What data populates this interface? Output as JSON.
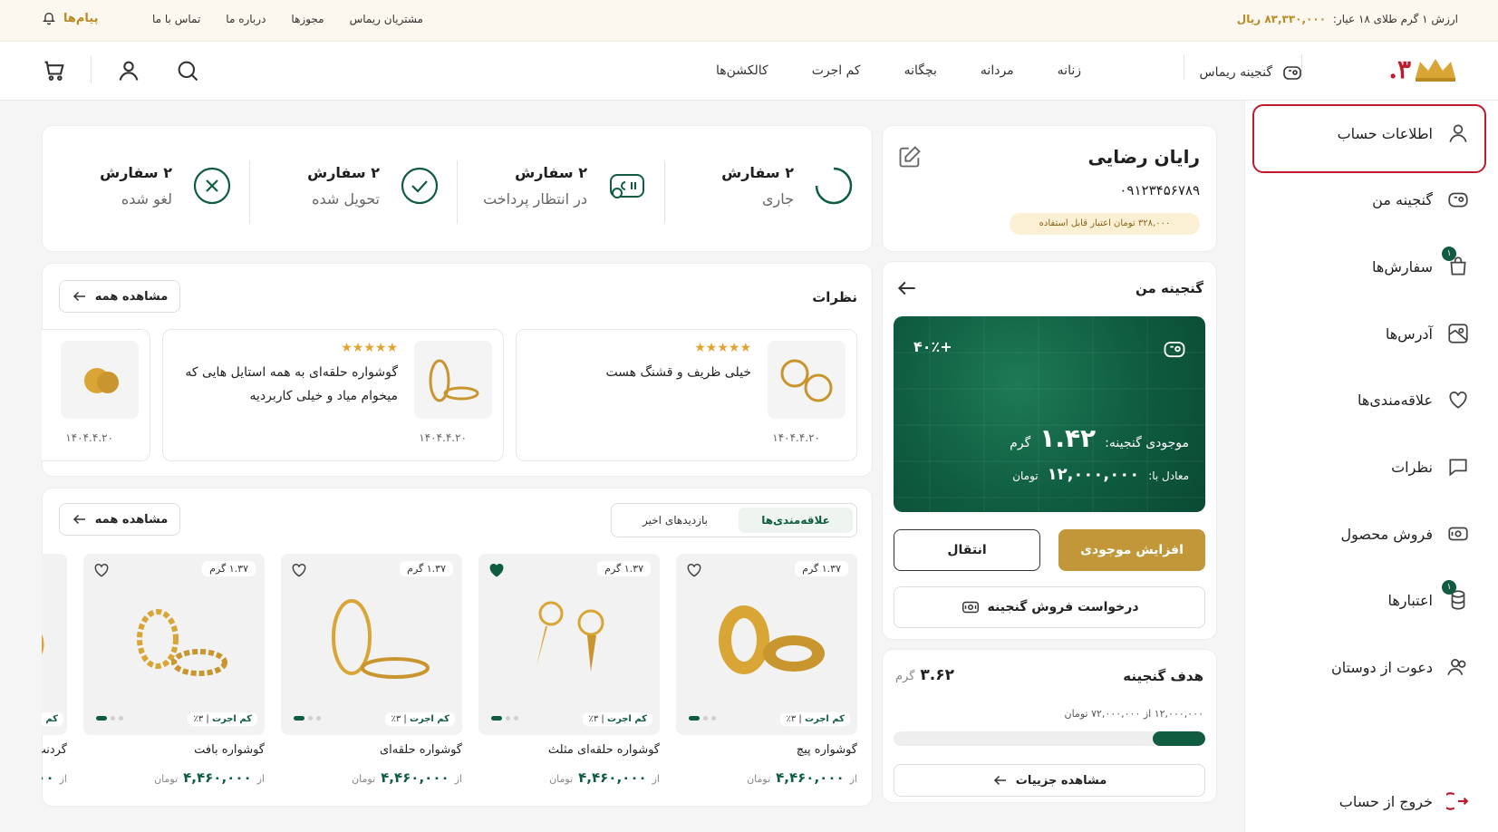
{
  "topbar": {
    "gold_label": "ارزش ۱ گرم طلای ۱۸ عیار:",
    "gold_value": "۸۳,۳۳۰,۰۰۰ ریال",
    "links": [
      "مشتریان ریماس",
      "مجوزها",
      "درباره ما",
      "تماس با ما"
    ],
    "messages": "پیام‌ها"
  },
  "header": {
    "logo_text": "۳.",
    "treasure": "گنجینه ریماس",
    "nav": [
      "زنانه",
      "مردانه",
      "بچگانه",
      "کم اجرت",
      "کالکشن‌ها"
    ]
  },
  "sidebar": {
    "items": [
      {
        "label": "اطلاعات حساب",
        "icon": "user-icon"
      },
      {
        "label": "گنجینه من",
        "icon": "piggy-bank-icon"
      },
      {
        "label": "سفارش‌ها",
        "icon": "shopping-bag-icon",
        "badge": "۱"
      },
      {
        "label": "آدرس‌ها",
        "icon": "map-icon"
      },
      {
        "label": "علاقه‌مندی‌ها",
        "icon": "heart-icon"
      },
      {
        "label": "نظرات",
        "icon": "comment-icon"
      },
      {
        "label": "فروش محصول",
        "icon": "sell-icon"
      },
      {
        "label": "اعتبارها",
        "icon": "coins-icon",
        "badge": "۱"
      },
      {
        "label": "دعوت از دوستان",
        "icon": "users-icon"
      }
    ],
    "logout": "خروج از حساب"
  },
  "profile": {
    "name": "رایان رضایی",
    "phone": "۰۹۱۲۳۴۵۶۷۸۹",
    "credit": "۳۲۸,۰۰۰ تومان اعتبار قابل استفاده"
  },
  "orders": [
    {
      "count": "۲ سفارش",
      "label": "جاری",
      "icon": "spinner-icon"
    },
    {
      "count": "۲ سفارش",
      "label": "در انتظار پرداخت",
      "icon": "payment-icon"
    },
    {
      "count": "۲ سفارش",
      "label": "تحویل شده",
      "icon": "check-circle-icon"
    },
    {
      "count": "۲ سفارش",
      "label": "لغو شده",
      "icon": "cancel-circle-icon"
    }
  ],
  "treasure": {
    "title": "گنجینه من",
    "change": "+۴۰٪",
    "balance_label": "موجودی گنجینه:",
    "balance_value": "۱.۴۲",
    "balance_unit": "گرم",
    "equiv_label": "معادل با:",
    "equiv_value": "۱۲,۰۰۰,۰۰۰",
    "equiv_unit": "تومان",
    "increase_btn": "افزایش موجودی",
    "transfer_btn": "انتقال",
    "sell_btn": "درخواست فروش گنجینه"
  },
  "goal": {
    "title": "هدف گنجینه",
    "value": "۳.۶۲",
    "unit": "گرم",
    "progress_text": "۱۲,۰۰۰,۰۰۰ از ۷۲,۰۰۰,۰۰۰ تومان",
    "progress": 0.17,
    "details_btn": "مشاهده جزییات"
  },
  "reviews": {
    "title": "نظرات",
    "view_all": "مشاهده همه",
    "items": [
      {
        "text": "خیلی ظریف و قشنگ هست",
        "date": "۱۴۰۴.۴.۲۰",
        "stars": "★★★★★"
      },
      {
        "text": "گوشواره حلقه‌ای به همه استایل هایی که میخوام میاد و خیلی کاربردیه",
        "date": "۱۴۰۴.۴.۲۰",
        "stars": "★★★★★"
      },
      {
        "text": "",
        "date": "۱۴۰۴.۴.۲۰",
        "stars": "★"
      }
    ]
  },
  "favorites": {
    "tabs": [
      "علاقه‌مندی‌ها",
      "بازدیدهای اخیر"
    ],
    "view_all": "مشاهده همه",
    "products": [
      {
        "name": "گوشواره پیچ",
        "weight": "۱.۳۷ گرم",
        "fee": "کم اجرت",
        "fee_pct": "۳٪",
        "from": "از",
        "price": "۴,۴۶۰,۰۰۰",
        "unit": "تومان",
        "liked": false
      },
      {
        "name": "گوشواره حلقه‌ای مثلث",
        "weight": "۱.۳۷ گرم",
        "fee": "کم اجرت",
        "fee_pct": "۳٪",
        "from": "از",
        "price": "۴,۴۶۰,۰۰۰",
        "unit": "تومان",
        "liked": true
      },
      {
        "name": "گوشواره حلقه‌ای",
        "weight": "۱.۳۷ گرم",
        "fee": "کم اجرت",
        "fee_pct": "۳٪",
        "from": "از",
        "price": "۴,۴۶۰,۰۰۰",
        "unit": "تومان",
        "liked": false
      },
      {
        "name": "گوشواره بافت",
        "weight": "۱.۳۷ گرم",
        "fee": "کم اجرت",
        "fee_pct": "۳٪",
        "from": "از",
        "price": "۴,۴۶۰,۰۰۰",
        "unit": "تومان",
        "liked": false
      },
      {
        "name": "گردنب",
        "weight": "",
        "fee": "کم",
        "fee_pct": "",
        "from": "از",
        "price": "۰۰۰",
        "unit": "",
        "liked": false
      }
    ]
  },
  "colors": {
    "brand_green": "#0f5c40",
    "gold": "#b98a24",
    "selected_border": "#c0182c"
  }
}
